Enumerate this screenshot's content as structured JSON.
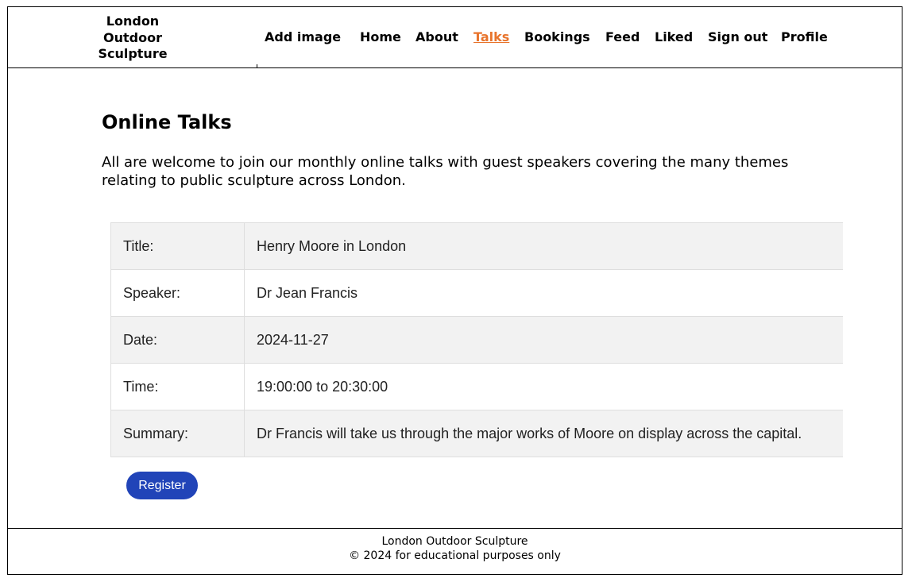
{
  "site": {
    "brand_line1": "London",
    "brand_line2": "Outdoor",
    "brand_line3": "Sculpture"
  },
  "nav": {
    "items": [
      {
        "label": "Add image",
        "active": false
      },
      {
        "label": "Home",
        "active": false
      },
      {
        "label": "About",
        "active": false
      },
      {
        "label": "Talks",
        "active": true
      },
      {
        "label": "Bookings",
        "active": false
      },
      {
        "label": "Feed",
        "active": false
      },
      {
        "label": "Liked",
        "active": false
      },
      {
        "label": "Sign out",
        "active": false
      },
      {
        "label": "Profile",
        "active": false
      }
    ],
    "active_color": "#e8742c"
  },
  "main": {
    "title": "Online Talks",
    "intro": "All are welcome to join our monthly online talks with guest speakers covering the many themes relating to public sculpture across London.",
    "talk": {
      "rows": [
        {
          "label": "Title:",
          "value": "Henry Moore in London"
        },
        {
          "label": "Speaker:",
          "value": "Dr Jean Francis"
        },
        {
          "label": "Date:",
          "value": "2024-11-27"
        },
        {
          "label": "Time:",
          "value": "19:00:00 to 20:30:00"
        },
        {
          "label": "Summary:",
          "value": "Dr Francis will take us through the major works of Moore on display across the capital."
        }
      ]
    },
    "register_label": "Register",
    "register_color": "#2144b8"
  },
  "footer": {
    "line1": "London Outdoor Sculpture",
    "line2": "© 2024 for educational purposes only"
  }
}
